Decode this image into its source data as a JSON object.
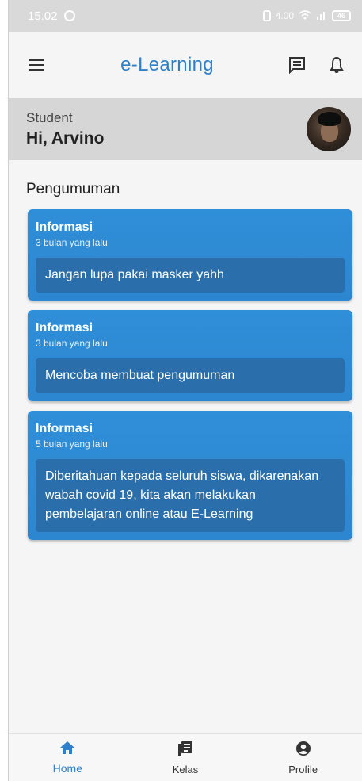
{
  "status_bar": {
    "time": "15.02",
    "net_speed": "4.00",
    "battery": "46"
  },
  "app_bar": {
    "title": "e-Learning"
  },
  "profile": {
    "role": "Student",
    "greeting": "Hi, Arvino"
  },
  "announcements": {
    "title": "Pengumuman",
    "items": [
      {
        "title": "Informasi",
        "time": "3 bulan yang lalu",
        "body": "Jangan lupa pakai masker yahh"
      },
      {
        "title": "Informasi",
        "time": "3 bulan yang lalu",
        "body": "Mencoba membuat pengumuman"
      },
      {
        "title": "Informasi",
        "time": "5 bulan yang lalu",
        "body": "Diberitahuan kepada seluruh siswa, dikarenakan wabah covid 19, kita akan melakukan pembelajaran online atau E-Learning"
      }
    ]
  },
  "bottom_nav": {
    "items": [
      {
        "label": "Home",
        "icon": "home-icon",
        "active": true
      },
      {
        "label": "Kelas",
        "icon": "book-icon",
        "active": false
      },
      {
        "label": "Profile",
        "icon": "account-circle-icon",
        "active": false
      }
    ]
  },
  "colors": {
    "accent": "#2f80c9",
    "card": "#2f8fd8",
    "card_body": "#2a6fab"
  }
}
